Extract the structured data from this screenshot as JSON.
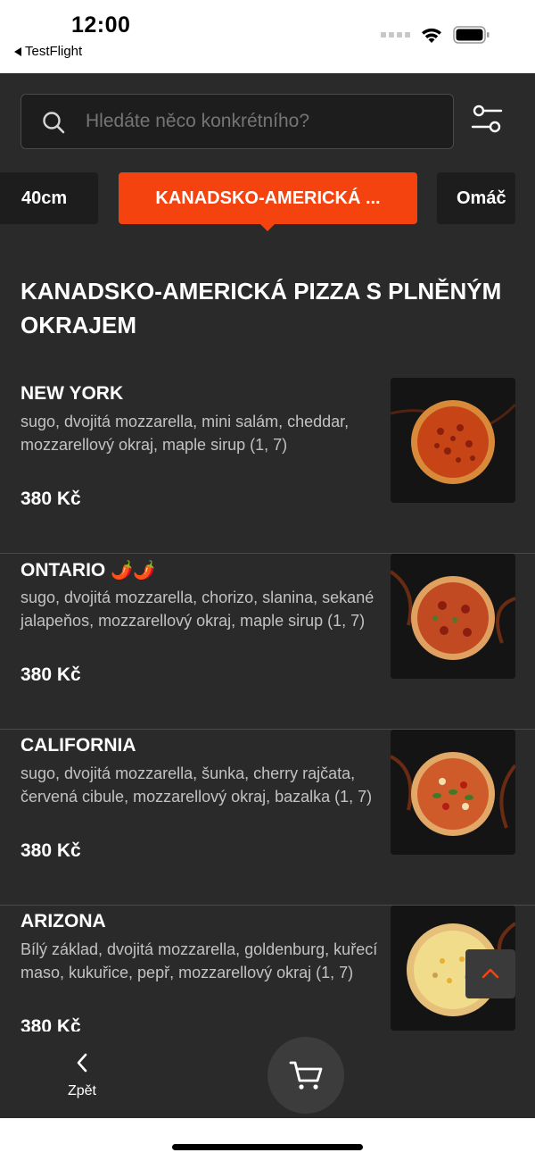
{
  "status_bar": {
    "time": "12:00",
    "back_app": "TestFlight"
  },
  "search": {
    "placeholder": "Hledáte něco konkrétního?"
  },
  "categories": [
    {
      "label": "40cm"
    },
    {
      "label": "KANADSKO-AMERICKÁ ..."
    },
    {
      "label": "Omáč"
    }
  ],
  "section": {
    "title": "KANADSKO-AMERICKÁ PIZZA S PLNĚNÝM OKRAJEM"
  },
  "menu_items": [
    {
      "name": "NEW YORK",
      "badge": "",
      "description": "sugo, dvojitá mozzarella, mini salám, cheddar, mozzarellový okraj, maple sirup (1, 7)",
      "price": "380 Kč"
    },
    {
      "name": "ONTARIO",
      "badge": "🌶️🌶️",
      "description": "sugo, dvojitá mozzarella, chorizo, slanina, sekané jalapeňos, mozzarellový okraj, maple sirup (1, 7)",
      "price": "380 Kč"
    },
    {
      "name": "CALIFORNIA",
      "badge": "",
      "description": "sugo, dvojitá mozzarella, šunka, cherry rajčata, červená cibule, mozzarellový okraj, bazalka (1, 7)",
      "price": "380 Kč"
    },
    {
      "name": "ARIZONA",
      "badge": "",
      "description": "Bílý základ, dvojitá mozzarella, goldenburg, kuřecí maso, kukuřice, pepř, mozzarellový okraj (1, 7)",
      "price": "380 Kč"
    }
  ],
  "bottom_nav": {
    "back_label": "Zpět",
    "back_icon": "chevron-left-icon",
    "cart_icon": "cart-icon"
  },
  "colors": {
    "accent": "#f4430f",
    "background": "#2a2a2a",
    "surface": "#1d1d1d"
  }
}
